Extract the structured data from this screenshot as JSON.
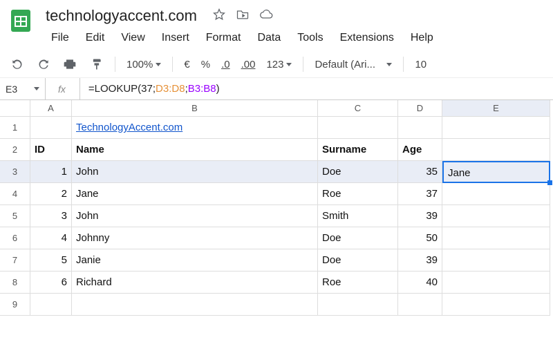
{
  "doc_title": "technologyaccent.com",
  "menu": {
    "items": [
      "File",
      "Edit",
      "View",
      "Insert",
      "Format",
      "Data",
      "Tools",
      "Extensions",
      "Help"
    ]
  },
  "toolbar": {
    "zoom": "100%",
    "currency": "€",
    "percent": "%",
    "dec_dec": ".0",
    "dec_inc": ".00",
    "format_num": "123",
    "font": "Default (Ari...",
    "font_size": "10"
  },
  "formula": {
    "cell_ref": "E3",
    "fx": "fx",
    "text_prefix": "=LOOKUP",
    "paren_open": "(",
    "arg1": "37",
    "semi1": ";",
    "ref_d": "D3:D8",
    "semi2": "; ",
    "ref_b": "B3:B8",
    "paren_close": ")"
  },
  "columns": [
    "A",
    "B",
    "C",
    "D",
    "E"
  ],
  "row_nums": [
    "1",
    "2",
    "3",
    "4",
    "5",
    "6",
    "7",
    "8",
    "9"
  ],
  "cells": {
    "B1_link": "TechnologyAccent.com",
    "A2": "ID",
    "B2": "Name",
    "C2": "Surname",
    "D2": "Age",
    "E3": "Jane"
  },
  "chart_data": {
    "type": "table",
    "columns": [
      "ID",
      "Name",
      "Surname",
      "Age"
    ],
    "rows": [
      {
        "ID": 1,
        "Name": "John",
        "Surname": "Doe",
        "Age": 35
      },
      {
        "ID": 2,
        "Name": "Jane",
        "Surname": "Roe",
        "Age": 37
      },
      {
        "ID": 3,
        "Name": "John",
        "Surname": "Smith",
        "Age": 39
      },
      {
        "ID": 4,
        "Name": "Johnny",
        "Surname": "Doe",
        "Age": 50
      },
      {
        "ID": 5,
        "Name": "Janie",
        "Surname": "Doe",
        "Age": 39
      },
      {
        "ID": 6,
        "Name": "Richard",
        "Surname": "Roe",
        "Age": 40
      }
    ]
  }
}
